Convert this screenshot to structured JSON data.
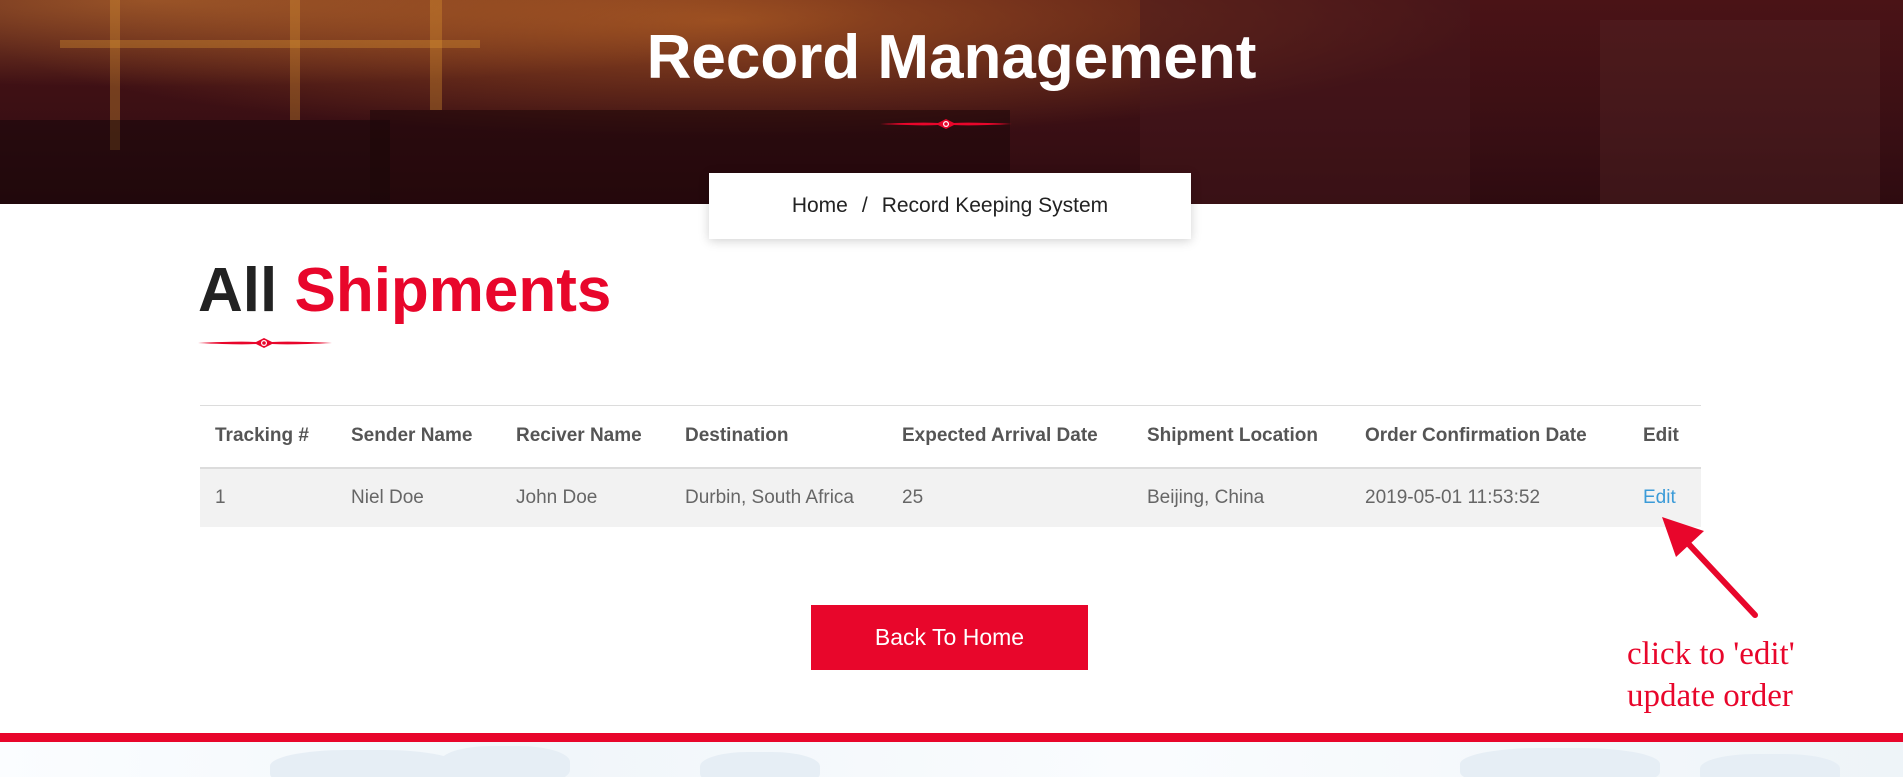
{
  "hero": {
    "title": "Record Management"
  },
  "breadcrumb": {
    "home_label": "Home",
    "separator": "/",
    "current_label": "Record Keeping System"
  },
  "section": {
    "title_plain": "All",
    "title_accent": "Shipments"
  },
  "table": {
    "headers": [
      "Tracking #",
      "Sender Name",
      "Reciver Name",
      "Destination",
      "Expected Arrival Date",
      "Shipment Location",
      "Order Confirmation Date",
      "Edit"
    ],
    "rows": [
      {
        "tracking": "1",
        "sender": "Niel Doe",
        "receiver": "John Doe",
        "destination": "Durbin, South Africa",
        "expected_arrival": "25",
        "location": "Beijing, China",
        "confirmation_date": "2019-05-01 11:53:52",
        "edit_label": "Edit"
      }
    ]
  },
  "actions": {
    "back_label": "Back To Home"
  },
  "annotation": {
    "line1": "click to 'edit'",
    "line2": "update order"
  },
  "colors": {
    "accent": "#e8062b",
    "link": "#3b9bd8"
  }
}
